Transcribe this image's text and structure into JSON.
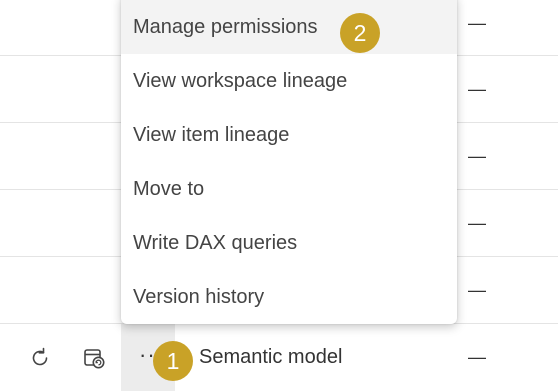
{
  "menu": {
    "items": [
      {
        "label": "Manage permissions",
        "active": true
      },
      {
        "label": "View workspace lineage",
        "active": false
      },
      {
        "label": "View item lineage",
        "active": false
      },
      {
        "label": "Move to",
        "active": false
      },
      {
        "label": "Write DAX queries",
        "active": false
      },
      {
        "label": "Version history",
        "active": false
      }
    ]
  },
  "table": {
    "dash": "—",
    "bottom_row": {
      "refresh_icon": "refresh-icon",
      "schedule_icon": "schedule-refresh-icon",
      "more_label": "··",
      "type": "Semantic model"
    }
  },
  "callouts": {
    "step1": "1",
    "step2": "2",
    "color": "#c9a227"
  }
}
